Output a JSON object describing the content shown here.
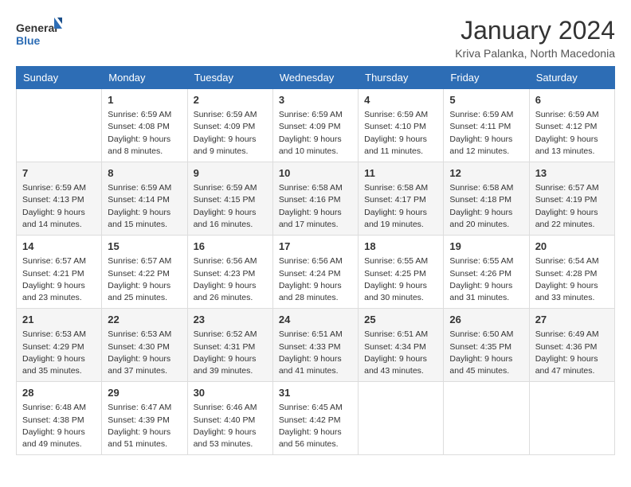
{
  "header": {
    "logo_general": "General",
    "logo_blue": "Blue",
    "month_year": "January 2024",
    "location": "Kriva Palanka, North Macedonia"
  },
  "weekdays": [
    "Sunday",
    "Monday",
    "Tuesday",
    "Wednesday",
    "Thursday",
    "Friday",
    "Saturday"
  ],
  "weeks": [
    [
      {
        "day": "",
        "sunrise": "",
        "sunset": "",
        "daylight": ""
      },
      {
        "day": "1",
        "sunrise": "Sunrise: 6:59 AM",
        "sunset": "Sunset: 4:08 PM",
        "daylight": "Daylight: 9 hours and 8 minutes."
      },
      {
        "day": "2",
        "sunrise": "Sunrise: 6:59 AM",
        "sunset": "Sunset: 4:09 PM",
        "daylight": "Daylight: 9 hours and 9 minutes."
      },
      {
        "day": "3",
        "sunrise": "Sunrise: 6:59 AM",
        "sunset": "Sunset: 4:09 PM",
        "daylight": "Daylight: 9 hours and 10 minutes."
      },
      {
        "day": "4",
        "sunrise": "Sunrise: 6:59 AM",
        "sunset": "Sunset: 4:10 PM",
        "daylight": "Daylight: 9 hours and 11 minutes."
      },
      {
        "day": "5",
        "sunrise": "Sunrise: 6:59 AM",
        "sunset": "Sunset: 4:11 PM",
        "daylight": "Daylight: 9 hours and 12 minutes."
      },
      {
        "day": "6",
        "sunrise": "Sunrise: 6:59 AM",
        "sunset": "Sunset: 4:12 PM",
        "daylight": "Daylight: 9 hours and 13 minutes."
      }
    ],
    [
      {
        "day": "7",
        "sunrise": "Sunrise: 6:59 AM",
        "sunset": "Sunset: 4:13 PM",
        "daylight": "Daylight: 9 hours and 14 minutes."
      },
      {
        "day": "8",
        "sunrise": "Sunrise: 6:59 AM",
        "sunset": "Sunset: 4:14 PM",
        "daylight": "Daylight: 9 hours and 15 minutes."
      },
      {
        "day": "9",
        "sunrise": "Sunrise: 6:59 AM",
        "sunset": "Sunset: 4:15 PM",
        "daylight": "Daylight: 9 hours and 16 minutes."
      },
      {
        "day": "10",
        "sunrise": "Sunrise: 6:58 AM",
        "sunset": "Sunset: 4:16 PM",
        "daylight": "Daylight: 9 hours and 17 minutes."
      },
      {
        "day": "11",
        "sunrise": "Sunrise: 6:58 AM",
        "sunset": "Sunset: 4:17 PM",
        "daylight": "Daylight: 9 hours and 19 minutes."
      },
      {
        "day": "12",
        "sunrise": "Sunrise: 6:58 AM",
        "sunset": "Sunset: 4:18 PM",
        "daylight": "Daylight: 9 hours and 20 minutes."
      },
      {
        "day": "13",
        "sunrise": "Sunrise: 6:57 AM",
        "sunset": "Sunset: 4:19 PM",
        "daylight": "Daylight: 9 hours and 22 minutes."
      }
    ],
    [
      {
        "day": "14",
        "sunrise": "Sunrise: 6:57 AM",
        "sunset": "Sunset: 4:21 PM",
        "daylight": "Daylight: 9 hours and 23 minutes."
      },
      {
        "day": "15",
        "sunrise": "Sunrise: 6:57 AM",
        "sunset": "Sunset: 4:22 PM",
        "daylight": "Daylight: 9 hours and 25 minutes."
      },
      {
        "day": "16",
        "sunrise": "Sunrise: 6:56 AM",
        "sunset": "Sunset: 4:23 PM",
        "daylight": "Daylight: 9 hours and 26 minutes."
      },
      {
        "day": "17",
        "sunrise": "Sunrise: 6:56 AM",
        "sunset": "Sunset: 4:24 PM",
        "daylight": "Daylight: 9 hours and 28 minutes."
      },
      {
        "day": "18",
        "sunrise": "Sunrise: 6:55 AM",
        "sunset": "Sunset: 4:25 PM",
        "daylight": "Daylight: 9 hours and 30 minutes."
      },
      {
        "day": "19",
        "sunrise": "Sunrise: 6:55 AM",
        "sunset": "Sunset: 4:26 PM",
        "daylight": "Daylight: 9 hours and 31 minutes."
      },
      {
        "day": "20",
        "sunrise": "Sunrise: 6:54 AM",
        "sunset": "Sunset: 4:28 PM",
        "daylight": "Daylight: 9 hours and 33 minutes."
      }
    ],
    [
      {
        "day": "21",
        "sunrise": "Sunrise: 6:53 AM",
        "sunset": "Sunset: 4:29 PM",
        "daylight": "Daylight: 9 hours and 35 minutes."
      },
      {
        "day": "22",
        "sunrise": "Sunrise: 6:53 AM",
        "sunset": "Sunset: 4:30 PM",
        "daylight": "Daylight: 9 hours and 37 minutes."
      },
      {
        "day": "23",
        "sunrise": "Sunrise: 6:52 AM",
        "sunset": "Sunset: 4:31 PM",
        "daylight": "Daylight: 9 hours and 39 minutes."
      },
      {
        "day": "24",
        "sunrise": "Sunrise: 6:51 AM",
        "sunset": "Sunset: 4:33 PM",
        "daylight": "Daylight: 9 hours and 41 minutes."
      },
      {
        "day": "25",
        "sunrise": "Sunrise: 6:51 AM",
        "sunset": "Sunset: 4:34 PM",
        "daylight": "Daylight: 9 hours and 43 minutes."
      },
      {
        "day": "26",
        "sunrise": "Sunrise: 6:50 AM",
        "sunset": "Sunset: 4:35 PM",
        "daylight": "Daylight: 9 hours and 45 minutes."
      },
      {
        "day": "27",
        "sunrise": "Sunrise: 6:49 AM",
        "sunset": "Sunset: 4:36 PM",
        "daylight": "Daylight: 9 hours and 47 minutes."
      }
    ],
    [
      {
        "day": "28",
        "sunrise": "Sunrise: 6:48 AM",
        "sunset": "Sunset: 4:38 PM",
        "daylight": "Daylight: 9 hours and 49 minutes."
      },
      {
        "day": "29",
        "sunrise": "Sunrise: 6:47 AM",
        "sunset": "Sunset: 4:39 PM",
        "daylight": "Daylight: 9 hours and 51 minutes."
      },
      {
        "day": "30",
        "sunrise": "Sunrise: 6:46 AM",
        "sunset": "Sunset: 4:40 PM",
        "daylight": "Daylight: 9 hours and 53 minutes."
      },
      {
        "day": "31",
        "sunrise": "Sunrise: 6:45 AM",
        "sunset": "Sunset: 4:42 PM",
        "daylight": "Daylight: 9 hours and 56 minutes."
      },
      {
        "day": "",
        "sunrise": "",
        "sunset": "",
        "daylight": ""
      },
      {
        "day": "",
        "sunrise": "",
        "sunset": "",
        "daylight": ""
      },
      {
        "day": "",
        "sunrise": "",
        "sunset": "",
        "daylight": ""
      }
    ]
  ]
}
